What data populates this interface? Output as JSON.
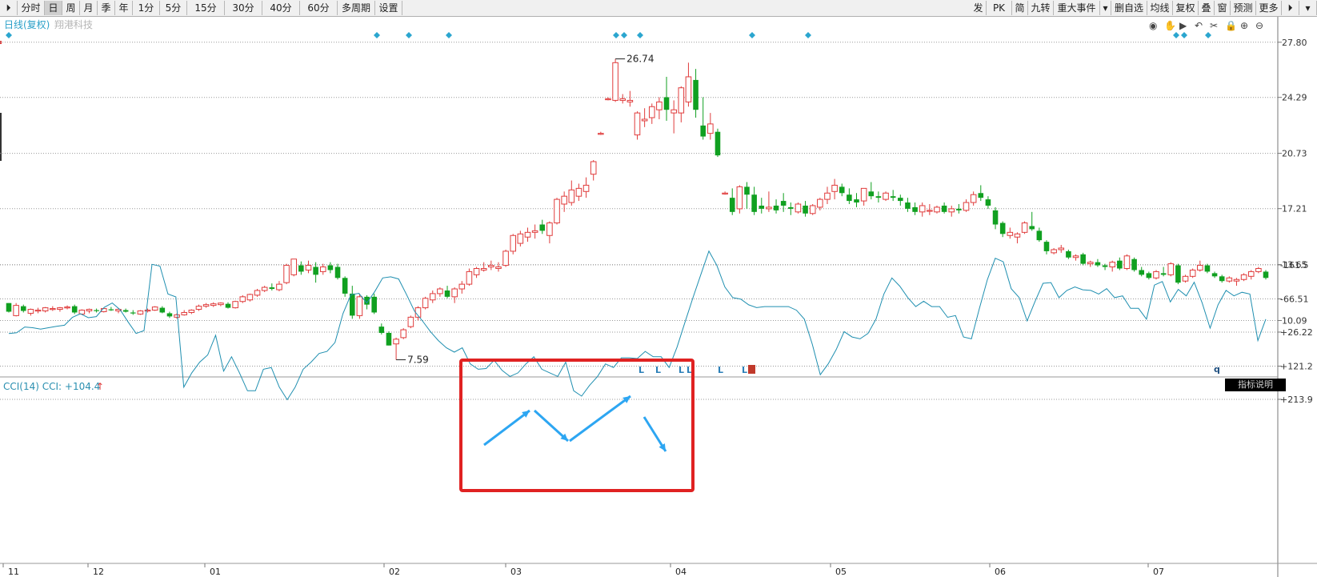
{
  "toolbar": {
    "left_items": [
      "分时",
      "日",
      "周",
      "月",
      "季",
      "年",
      "1分",
      "5分",
      "15分",
      "30分",
      "40分",
      "60分",
      "多周期",
      "设置"
    ],
    "right_items": [
      "发",
      "PK",
      "简",
      "九转",
      "重大事件",
      "▾",
      "删自选",
      "均线",
      "复权",
      "叠",
      "窗",
      "预测",
      "更多"
    ],
    "active": "日"
  },
  "header": {
    "title": "日线(复权)",
    "stock_name": "翔港科技"
  },
  "annotations": {
    "high_label": "26.74",
    "low_label": "7.59"
  },
  "indicator": {
    "name": "CCI(14)",
    "label": "CCI:",
    "value": "+104.4",
    "arrow": "↑",
    "help_button": "指标说明"
  },
  "signals": {
    "letter": "L",
    "extra": "q"
  },
  "colors": {
    "up": "#e03c3c",
    "down": "#10a020",
    "cci_line": "#1f8fb0",
    "arrow": "#2da6f2",
    "frame": "#e02222",
    "diamond": "#2ba6cf"
  },
  "chart_data": [
    {
      "type": "candlestick",
      "title": "日线(复权)",
      "y_ticks": [
        27.8,
        24.29,
        20.73,
        17.21,
        13.65,
        10.09
      ],
      "x_ticks": [
        "11",
        "12",
        "01",
        "02",
        "03",
        "04",
        "05",
        "06",
        "07"
      ],
      "ylim": [
        6.6,
        28.4
      ],
      "grid": true,
      "candles_ohlc": [
        [
          11.2,
          11.2,
          10.6,
          10.65
        ],
        [
          10.4,
          11.2,
          10.35,
          11.05
        ],
        [
          11.0,
          11.1,
          10.6,
          10.7
        ],
        [
          10.55,
          10.85,
          10.4,
          10.8
        ],
        [
          10.7,
          10.9,
          10.55,
          10.75
        ],
        [
          10.7,
          10.95,
          10.6,
          10.9
        ],
        [
          10.85,
          11.0,
          10.7,
          10.85
        ],
        [
          10.8,
          10.95,
          10.65,
          10.9
        ],
        [
          10.9,
          11.05,
          10.8,
          10.95
        ],
        [
          11.0,
          11.1,
          10.5,
          10.6
        ],
        [
          10.5,
          10.8,
          10.45,
          10.75
        ],
        [
          10.7,
          10.85,
          10.55,
          10.8
        ],
        [
          10.75,
          10.85,
          10.6,
          10.7
        ],
        [
          10.65,
          10.9,
          10.6,
          10.85
        ],
        [
          10.8,
          10.95,
          10.7,
          10.75
        ],
        [
          10.7,
          10.85,
          10.55,
          10.8
        ],
        [
          10.75,
          10.85,
          10.6,
          10.65
        ],
        [
          10.6,
          10.75,
          10.45,
          10.55
        ],
        [
          10.5,
          10.75,
          10.45,
          10.7
        ],
        [
          10.7,
          10.85,
          10.6,
          10.75
        ],
        [
          10.75,
          11.0,
          10.7,
          10.95
        ],
        [
          10.9,
          11.0,
          10.55,
          10.6
        ],
        [
          10.55,
          10.65,
          10.25,
          10.35
        ],
        [
          10.3,
          10.55,
          10.2,
          10.45
        ],
        [
          10.45,
          10.75,
          10.4,
          10.6
        ],
        [
          10.6,
          10.8,
          10.5,
          10.75
        ],
        [
          10.8,
          11.1,
          10.7,
          11.0
        ],
        [
          11.0,
          11.2,
          10.9,
          11.1
        ],
        [
          11.05,
          11.25,
          10.95,
          11.15
        ],
        [
          11.1,
          11.25,
          11.0,
          11.2
        ],
        [
          11.15,
          11.25,
          10.85,
          10.9
        ],
        [
          10.9,
          11.35,
          10.85,
          11.3
        ],
        [
          11.3,
          11.7,
          11.2,
          11.6
        ],
        [
          11.4,
          11.8,
          11.3,
          11.75
        ],
        [
          11.7,
          12.1,
          11.6,
          12.0
        ],
        [
          12.0,
          12.3,
          11.9,
          12.2
        ],
        [
          12.2,
          12.45,
          12.0,
          12.1
        ],
        [
          12.05,
          12.6,
          11.95,
          12.4
        ],
        [
          12.5,
          13.7,
          12.4,
          13.6
        ],
        [
          13.0,
          14.0,
          12.9,
          14.0
        ],
        [
          13.6,
          13.85,
          13.0,
          13.2
        ],
        [
          13.3,
          13.9,
          13.1,
          13.6
        ],
        [
          13.5,
          13.8,
          12.5,
          13.0
        ],
        [
          13.2,
          13.7,
          13.0,
          13.5
        ],
        [
          13.6,
          13.8,
          13.1,
          13.3
        ],
        [
          13.5,
          13.7,
          12.7,
          12.8
        ],
        [
          12.8,
          12.9,
          11.6,
          11.8
        ],
        [
          11.8,
          12.3,
          10.2,
          10.4
        ],
        [
          10.4,
          11.8,
          10.2,
          11.6
        ],
        [
          11.6,
          11.7,
          10.8,
          11.1
        ],
        [
          11.6,
          11.8,
          10.5,
          10.6
        ],
        [
          9.7,
          9.9,
          9.2,
          9.3
        ],
        [
          9.3,
          9.4,
          8.5,
          8.5
        ],
        [
          8.6,
          9.0,
          7.59,
          8.9
        ],
        [
          9.0,
          9.6,
          8.9,
          9.5
        ],
        [
          9.7,
          10.4,
          9.6,
          10.3
        ],
        [
          10.3,
          11.0,
          10.1,
          10.9
        ],
        [
          10.9,
          11.6,
          10.8,
          11.5
        ],
        [
          11.4,
          12.0,
          11.2,
          11.8
        ],
        [
          11.8,
          12.2,
          11.6,
          12.1
        ],
        [
          12.0,
          12.3,
          11.5,
          11.6
        ],
        [
          11.6,
          12.2,
          11.2,
          12.1
        ],
        [
          12.1,
          12.6,
          11.8,
          12.4
        ],
        [
          12.4,
          13.4,
          12.3,
          13.2
        ],
        [
          13.0,
          13.5,
          12.8,
          13.4
        ],
        [
          13.3,
          13.8,
          13.2,
          13.4
        ],
        [
          13.5,
          13.9,
          13.3,
          13.6
        ],
        [
          13.4,
          13.8,
          13.2,
          13.5
        ],
        [
          13.6,
          14.6,
          13.5,
          14.5
        ],
        [
          14.5,
          15.6,
          14.3,
          15.5
        ],
        [
          15.0,
          15.8,
          14.8,
          15.6
        ],
        [
          15.4,
          16.0,
          15.1,
          15.7
        ],
        [
          15.7,
          16.2,
          15.3,
          15.8
        ],
        [
          16.2,
          16.5,
          15.6,
          15.8
        ],
        [
          15.5,
          16.4,
          15.0,
          16.3
        ],
        [
          16.3,
          17.9,
          16.2,
          17.8
        ],
        [
          17.5,
          18.3,
          17.0,
          18.0
        ],
        [
          17.6,
          19.0,
          17.4,
          18.4
        ],
        [
          18.0,
          18.8,
          17.7,
          18.5
        ],
        [
          18.3,
          19.2,
          17.9,
          18.7
        ],
        [
          19.4,
          20.3,
          19.0,
          20.2
        ],
        [
          22.0,
          22.1,
          21.9,
          22.0
        ],
        [
          24.2,
          24.3,
          24.1,
          24.2
        ],
        [
          24.1,
          26.74,
          24.0,
          26.5
        ],
        [
          24.1,
          24.5,
          23.9,
          24.2
        ],
        [
          24.0,
          24.7,
          23.7,
          24.1
        ],
        [
          21.9,
          23.4,
          21.6,
          23.3
        ],
        [
          22.8,
          23.6,
          22.4,
          22.9
        ],
        [
          23.0,
          23.9,
          22.6,
          23.7
        ],
        [
          23.5,
          24.3,
          22.9,
          24.0
        ],
        [
          24.3,
          25.6,
          22.8,
          23.5
        ],
        [
          23.3,
          24.1,
          22.0,
          23.5
        ],
        [
          23.3,
          25.0,
          22.7,
          24.9
        ],
        [
          24.0,
          26.5,
          23.7,
          25.6
        ],
        [
          25.4,
          26.1,
          23.0,
          23.5
        ],
        [
          22.5,
          24.3,
          21.6,
          21.8
        ],
        [
          22.0,
          23.3,
          21.6,
          22.6
        ],
        [
          22.1,
          22.3,
          20.5,
          20.6
        ],
        [
          18.2,
          18.3,
          18.1,
          18.2
        ],
        [
          17.9,
          18.5,
          16.8,
          17.0
        ],
        [
          17.2,
          18.7,
          16.9,
          18.6
        ],
        [
          18.6,
          18.9,
          17.2,
          18.1
        ],
        [
          18.1,
          18.6,
          16.8,
          17.0
        ],
        [
          17.4,
          17.9,
          16.9,
          17.2
        ],
        [
          17.2,
          18.3,
          17.0,
          17.3
        ],
        [
          17.4,
          17.8,
          16.9,
          17.1
        ],
        [
          17.7,
          18.2,
          17.0,
          17.4
        ],
        [
          17.3,
          17.6,
          16.8,
          17.2
        ],
        [
          17.0,
          17.6,
          16.9,
          17.5
        ],
        [
          17.4,
          17.7,
          16.7,
          16.9
        ],
        [
          16.9,
          17.5,
          16.8,
          17.4
        ],
        [
          17.3,
          17.9,
          17.1,
          17.8
        ],
        [
          17.8,
          18.6,
          17.5,
          18.2
        ],
        [
          18.3,
          19.1,
          17.8,
          18.7
        ],
        [
          18.6,
          18.8,
          18.0,
          18.2
        ],
        [
          18.1,
          18.5,
          17.5,
          17.7
        ],
        [
          17.8,
          18.2,
          17.3,
          17.6
        ],
        [
          17.7,
          18.5,
          17.4,
          18.5
        ],
        [
          18.3,
          18.9,
          17.8,
          18.0
        ],
        [
          18.0,
          18.3,
          17.6,
          17.9
        ],
        [
          17.8,
          18.3,
          17.7,
          18.2
        ],
        [
          18.0,
          18.4,
          17.7,
          17.9
        ],
        [
          17.9,
          18.1,
          17.4,
          17.7
        ],
        [
          17.6,
          17.9,
          17.0,
          17.2
        ],
        [
          17.3,
          17.6,
          16.8,
          17.0
        ],
        [
          17.0,
          17.6,
          16.7,
          17.4
        ],
        [
          17.1,
          17.5,
          16.8,
          17.1
        ],
        [
          17.0,
          17.4,
          16.9,
          17.3
        ],
        [
          17.4,
          17.6,
          16.9,
          17.0
        ],
        [
          17.0,
          17.4,
          16.7,
          17.2
        ],
        [
          17.2,
          17.5,
          16.9,
          17.1
        ],
        [
          17.1,
          17.8,
          17.0,
          17.6
        ],
        [
          17.6,
          18.3,
          17.4,
          18.1
        ],
        [
          18.2,
          18.7,
          17.7,
          17.9
        ],
        [
          17.8,
          18.0,
          17.2,
          17.4
        ],
        [
          17.1,
          17.3,
          15.9,
          16.2
        ],
        [
          16.3,
          16.4,
          15.4,
          15.6
        ],
        [
          15.5,
          16.0,
          15.3,
          15.7
        ],
        [
          15.4,
          15.7,
          15.0,
          15.6
        ],
        [
          15.7,
          16.4,
          15.6,
          16.3
        ],
        [
          16.1,
          17.0,
          15.8,
          15.9
        ],
        [
          15.8,
          16.0,
          15.1,
          15.2
        ],
        [
          15.1,
          15.2,
          14.3,
          14.5
        ],
        [
          14.4,
          14.7,
          14.3,
          14.6
        ],
        [
          14.6,
          14.9,
          14.4,
          14.7
        ],
        [
          14.5,
          14.6,
          14.0,
          14.1
        ],
        [
          14.1,
          14.3,
          13.9,
          14.2
        ],
        [
          14.3,
          14.4,
          13.6,
          13.7
        ],
        [
          13.7,
          13.9,
          13.5,
          13.8
        ],
        [
          13.8,
          14.0,
          13.5,
          13.6
        ],
        [
          13.6,
          13.7,
          13.3,
          13.5
        ],
        [
          13.5,
          13.9,
          13.2,
          13.8
        ],
        [
          13.9,
          14.1,
          13.3,
          13.4
        ],
        [
          13.4,
          14.3,
          13.3,
          14.2
        ],
        [
          14.0,
          14.1,
          13.2,
          13.3
        ],
        [
          13.3,
          13.5,
          12.9,
          13.0
        ],
        [
          13.1,
          13.2,
          12.7,
          12.8
        ],
        [
          12.8,
          13.3,
          12.7,
          13.2
        ],
        [
          13.1,
          13.5,
          12.9,
          13.0
        ],
        [
          13.0,
          13.8,
          12.9,
          13.7
        ],
        [
          13.6,
          13.7,
          12.4,
          12.5
        ],
        [
          12.6,
          13.0,
          12.5,
          12.9
        ],
        [
          12.9,
          13.4,
          12.8,
          13.3
        ],
        [
          13.3,
          13.9,
          13.2,
          13.6
        ],
        [
          13.6,
          13.7,
          13.1,
          13.2
        ],
        [
          13.1,
          13.2,
          12.8,
          12.9
        ],
        [
          12.9,
          13.0,
          12.5,
          12.6
        ],
        [
          12.6,
          12.9,
          12.5,
          12.8
        ],
        [
          12.6,
          12.8,
          12.3,
          12.7
        ],
        [
          12.7,
          13.1,
          12.6,
          13.0
        ],
        [
          12.9,
          13.3,
          12.7,
          13.2
        ],
        [
          13.2,
          13.5,
          13.1,
          13.4
        ],
        [
          13.2,
          13.3,
          12.7,
          12.8
        ]
      ]
    },
    {
      "type": "line",
      "title": "CCI(14)",
      "y_ticks": [
        213.9,
        121.2,
        26.22,
        -66.51,
        -161.5
      ],
      "ylim": [
        -250,
        250
      ],
      "series": [
        {
          "name": "CCI",
          "values": [
            30,
            28,
            12,
            14,
            18,
            14,
            10,
            7,
            -15,
            -25,
            -14,
            -17,
            -43,
            -55,
            -36,
            -2,
            30,
            22,
            -163,
            -158,
            -80,
            -72,
            180,
            140,
            110,
            90,
            35,
            135,
            95,
            140,
            190,
            190,
            130,
            125,
            180,
            215,
            180,
            130,
            110,
            86,
            80,
            55,
            -25,
            -78,
            -82,
            -55,
            -87,
            -125,
            -128,
            -122,
            -78,
            -32,
            -5,
            25,
            50,
            70,
            82,
            70,
            115,
            130,
            128,
            105,
            133,
            150,
            140,
            115,
            95,
            130,
            140,
            150,
            110,
            190,
            205,
            175,
            150,
            115,
            125,
            98,
            98,
            100,
            80,
            95,
            95,
            125,
            68,
            -2,
            -70,
            -135,
            -200,
            -160,
            -100,
            -70,
            -66,
            -50,
            -42,
            -45,
            -45,
            -45,
            -45,
            -35,
            -10,
            60,
            145,
            115,
            75,
            25,
            40,
            45,
            30,
            -10,
            -80,
            -125,
            -102,
            -70,
            -45,
            -60,
            -45,
            -45,
            -15,
            -20,
            40,
            45,
            -40,
            -120,
            -180,
            -170,
            -95,
            -70,
            -5,
            -60,
            -110,
            -112,
            -70,
            -90,
            -100,
            -92,
            -90,
            -80,
            -95,
            -70,
            -75,
            -40,
            -40,
            -10,
            -105,
            -115,
            -58,
            -93,
            -75,
            -113,
            -55,
            15,
            -50,
            -90,
            -75,
            -85,
            -80,
            50,
            -10
          ]
        }
      ]
    }
  ]
}
